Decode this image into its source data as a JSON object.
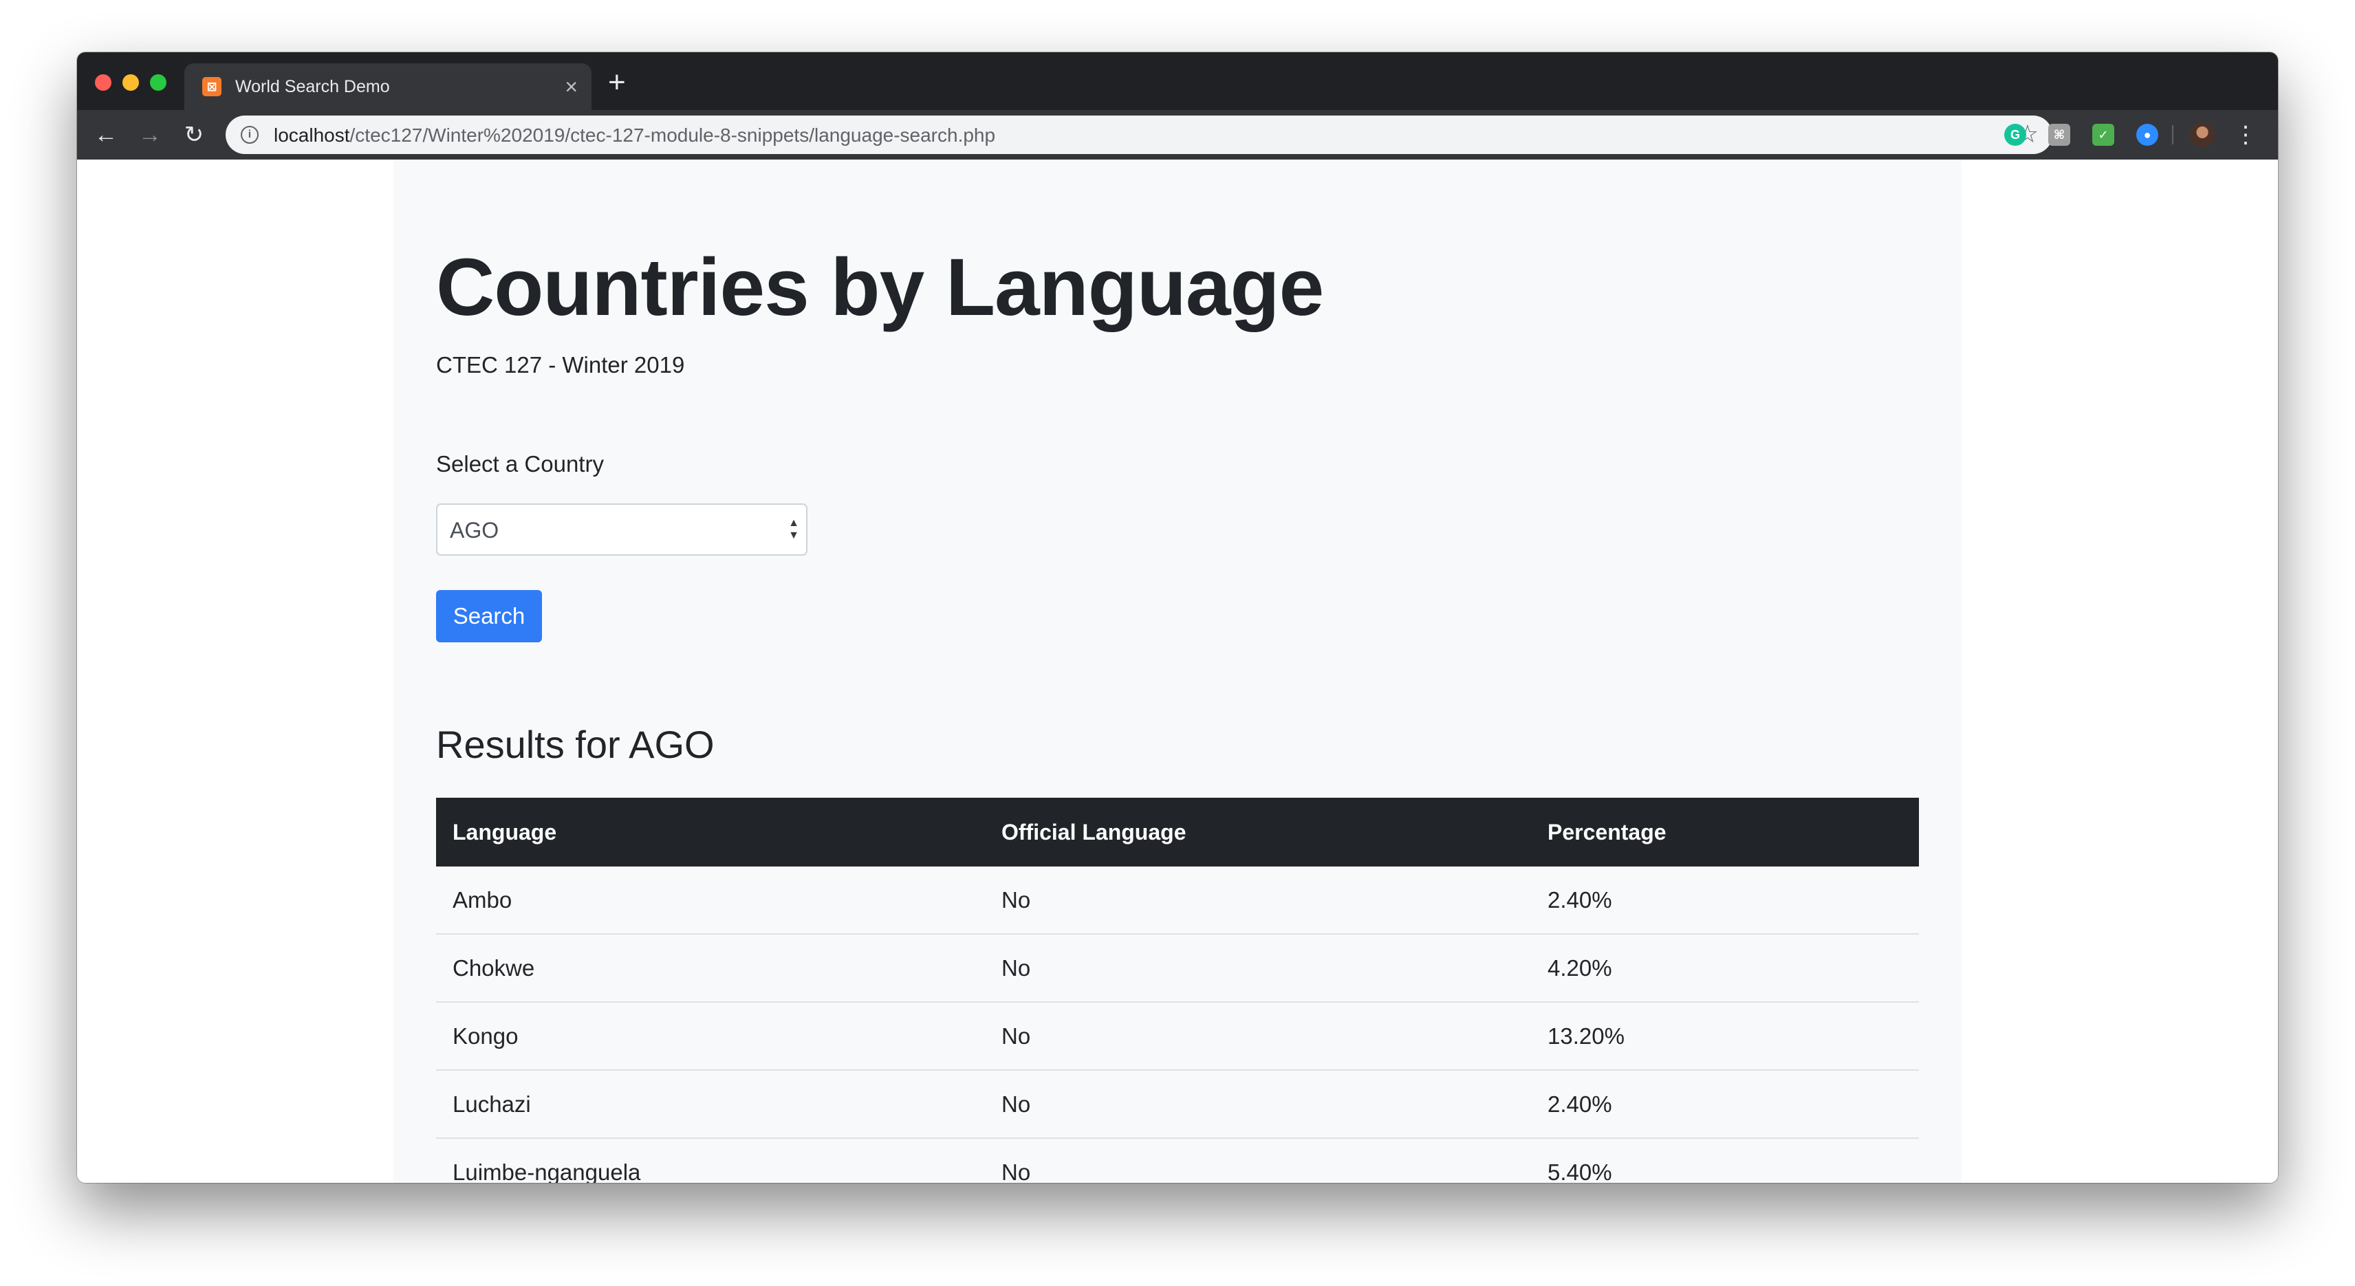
{
  "browser": {
    "tab_title": "World Search Demo",
    "tab_close": "×",
    "new_tab": "+",
    "url_host": "localhost",
    "url_path": "/ctec127/Winter%202019/ctec-127-module-8-snippets/language-search.php",
    "icons": [
      "back-icon",
      "forward-icon",
      "reload-icon",
      "info-icon",
      "star-icon",
      "grammarly-icon",
      "extension-icon",
      "translate-icon",
      "zoom-icon",
      "profile-avatar",
      "menu-icon"
    ]
  },
  "page": {
    "title": "Countries by Language",
    "subtitle": "CTEC 127 - Winter 2019",
    "form": {
      "label": "Select a Country",
      "selected": "AGO",
      "button": "Search"
    },
    "results_heading": "Results for AGO",
    "table": {
      "headers": [
        "Language",
        "Official Language",
        "Percentage"
      ],
      "rows": [
        [
          "Ambo",
          "No",
          "2.40%"
        ],
        [
          "Chokwe",
          "No",
          "4.20%"
        ],
        [
          "Kongo",
          "No",
          "13.20%"
        ],
        [
          "Luchazi",
          "No",
          "2.40%"
        ],
        [
          "Luimbe-nganguela",
          "No",
          "5.40%"
        ]
      ]
    }
  },
  "colors": {
    "primary_button": "#2f7cf6",
    "table_header": "#212529",
    "container_bg": "#f8f9fa"
  }
}
